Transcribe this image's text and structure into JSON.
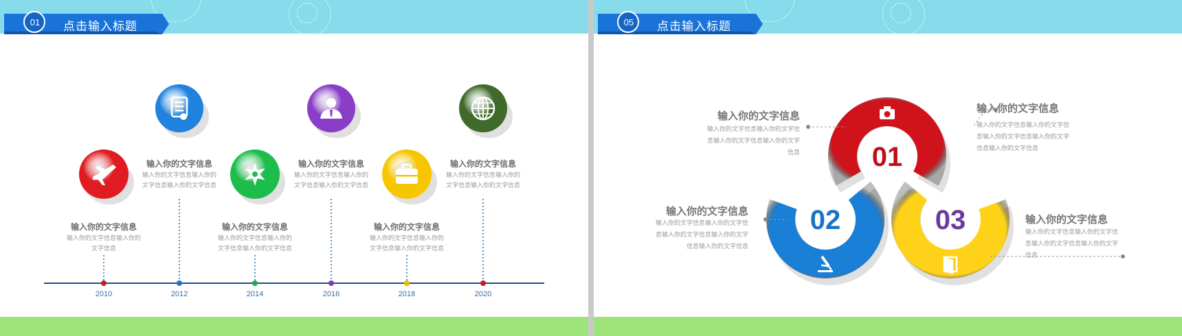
{
  "slide_left": {
    "badge_number": "01",
    "title": "点击输入标题",
    "timeline": [
      {
        "year": "2010",
        "title": "输入你的文字信息",
        "desc": "输入你的文字信息输入你的文字信息",
        "icon": "airplane-icon",
        "color": "#e01c22",
        "dot_color": "#cc1b22"
      },
      {
        "year": "2012",
        "title": "输入你的文字信息",
        "desc": "输入你的文字信息输入你的文字信息输入你的文字信息",
        "icon": "certificate-document-icon",
        "color": "#1f82dd",
        "dot_color": "#2175c8"
      },
      {
        "year": "2014",
        "title": "输入你的文字信息",
        "desc": "输入你的文字信息输入你的文字信息输入你的文字信息",
        "icon": "sheriff-star-icon",
        "color": "#1dbd4c",
        "dot_color": "#22a84a"
      },
      {
        "year": "2016",
        "title": "输入你的文字信息",
        "desc": "输入你的文字信息输入你的文字信息输入你的文字信息",
        "icon": "businessman-icon",
        "color": "#8a3ec7",
        "dot_color": "#7e3ab8"
      },
      {
        "year": "2018",
        "title": "输入你的文字信息",
        "desc": "输入你的文字信息输入你的文字信息输入你的文字信息",
        "icon": "briefcase-icon",
        "color": "#f7c600",
        "dot_color": "#f0b800"
      },
      {
        "year": "2020",
        "title": "输入你的文字信息",
        "desc": "输入你的文字信息输入你的文字信息输入你的文字信息",
        "icon": "globe-icon",
        "color": "#3f6a2c",
        "dot_color": "#cc1b22"
      }
    ]
  },
  "slide_right": {
    "badge_number": "05",
    "title": "点击输入标题",
    "rings": [
      {
        "number": "01",
        "color": "#d0121b",
        "text_color": "#c10e17",
        "icon": "camera-icon"
      },
      {
        "number": "02",
        "color": "#1a7fd6",
        "text_color": "#1a73c5",
        "icon": "microscope-icon"
      },
      {
        "number": "03",
        "color": "#ffd21a",
        "text_color": "#6b3aa0",
        "icon": "door-icon"
      }
    ],
    "labels": [
      {
        "title": "输入你的文字信息",
        "desc": "输入你的文字信息输入你的文字信息输入你的文字信息输入你的文字信息"
      },
      {
        "title": "输入你的文字信息",
        "desc": "输入你的文字信息输入你的文字信息输入你的文字信息输入你的文字信息输入你的文字信息"
      },
      {
        "title": "输入你的文字信息",
        "desc": "输入你的文字信息输入你的文字信息输入你的文字信息输入你的文字信息输入你的文字信息"
      },
      {
        "title": "输入你的文字信息",
        "desc": "输入你的文字信息输入你的文字信息输入你的文字信息输入你的文字信息"
      }
    ]
  }
}
